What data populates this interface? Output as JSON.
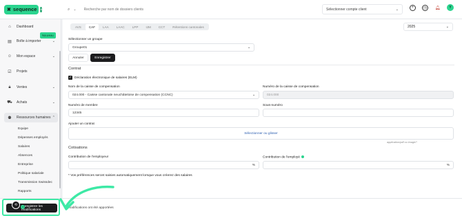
{
  "header": {
    "logo_text": "sequence",
    "logo_badge": "8",
    "search_placeholder": "Recherche par nom de dossiers clients",
    "account_placeholder": "Sélectionner compte client",
    "avatar_initial": "Y"
  },
  "sidebar": {
    "items": [
      {
        "label": "Dashboard",
        "icon": "home-icon"
      },
      {
        "label": "Boîte à importer",
        "icon": "inbox-icon",
        "badge": "Nouveau"
      },
      {
        "label": "Mon espace",
        "icon": "user-icon"
      },
      {
        "label": "Projets",
        "icon": "check-square-icon"
      },
      {
        "label": "Ventes",
        "icon": "lock-icon"
      },
      {
        "label": "Achats",
        "icon": "cart-icon"
      },
      {
        "label": "Ressources humaines",
        "icon": "people-icon"
      }
    ],
    "sub_items": [
      "Equipe",
      "Dépenses employés",
      "Salaires",
      "Absences",
      "Entreprise",
      "Politique salariale",
      "Transmission Swissdec",
      "Rapports"
    ]
  },
  "tabs": [
    "AVS",
    "CAF",
    "LAA",
    "LAAC",
    "LPP",
    "IJM",
    "CCT",
    "Rétentions cantonales"
  ],
  "active_tab": "CAF",
  "year": "2025",
  "form": {
    "group_label": "Sélectionner un groupe",
    "group_value": "Groupe01",
    "cancel_label": "Annuler",
    "save_label": "Enregistrer",
    "contract_heading": "Contrat",
    "elm_label": "Déclaration électronique de salaires (ELM)",
    "caisse_name_label": "Nom de la caisse de compensation",
    "caisse_name_value": "024.000 - Caisse cantonale neuchâteloise de compensation (CCNC)",
    "caisse_number_label": "Numéro de la caisse de compensation",
    "caisse_number_value": "024.000",
    "member_number_label": "Numéro de membre",
    "member_number_value": "12345",
    "sub_number_label": "Sous-numéro",
    "contract_add_label": "Ajouter un contrat",
    "upload_label": "Sélectionner ou glisser",
    "upload_hint": "application/pdf ou image/*",
    "cotisations_heading": "Cotisations",
    "employer_label": "Contribution de l'employeur",
    "employee_label": "Contribution de l'employé",
    "percent_symbol": "%",
    "footnote": "* Vos préférences seront saisies automatiquement lorsque vous créerez des salaires"
  },
  "footer": {
    "save_all_label": "Enregistrer les modifications",
    "changes_count": "1",
    "notice": "1 modifications ont été apportées"
  },
  "colors": {
    "accent": "#2bd48f",
    "highlight": "#3ee9a6",
    "dark": "#1c1c1e"
  }
}
